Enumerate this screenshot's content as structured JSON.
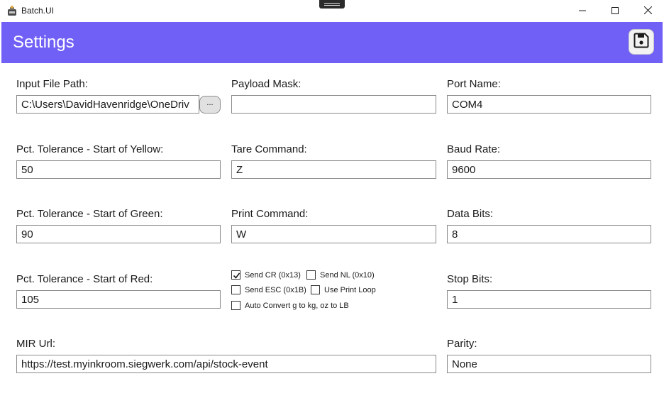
{
  "window": {
    "app_title": "Batch.UI"
  },
  "header": {
    "title": "Settings"
  },
  "colors": {
    "accent": "#7160f6"
  },
  "form": {
    "input_file_path": {
      "label": "Input File Path:",
      "value": "C:\\Users\\DavidHavenridge\\OneDriv",
      "browse_label": "..."
    },
    "payload_mask": {
      "label": "Payload Mask:",
      "value": ""
    },
    "port_name": {
      "label": "Port Name:",
      "value": "COM4"
    },
    "yellow_tolerance": {
      "label": "Pct. Tolerance - Start of Yellow:",
      "value": "50"
    },
    "tare_command": {
      "label": "Tare Command:",
      "value": "Z"
    },
    "baud_rate": {
      "label": "Baud Rate:",
      "value": "9600"
    },
    "green_tolerance": {
      "label": "Pct. Tolerance - Start of Green:",
      "value": "90"
    },
    "print_command": {
      "label": "Print Command:",
      "value": "W"
    },
    "data_bits": {
      "label": "Data Bits:",
      "value": "8"
    },
    "red_tolerance": {
      "label": "Pct. Tolerance - Start of Red:",
      "value": "105"
    },
    "stop_bits": {
      "label": "Stop Bits:",
      "value": "1"
    },
    "mir_url": {
      "label": "MIR Url:",
      "value": "https://test.myinkroom.siegwerk.com/api/stock-event"
    },
    "parity": {
      "label": "Parity:",
      "value": "None"
    },
    "checkboxes": {
      "send_cr": {
        "label": "Send CR (0x13)",
        "checked": true
      },
      "send_nl": {
        "label": "Send NL (0x10)",
        "checked": false
      },
      "send_esc": {
        "label": "Send ESC (0x1B)",
        "checked": false
      },
      "use_print_loop": {
        "label": "Use Print Loop",
        "checked": false
      },
      "auto_convert": {
        "label": "Auto Convert g to kg, oz to LB",
        "checked": false
      }
    }
  }
}
